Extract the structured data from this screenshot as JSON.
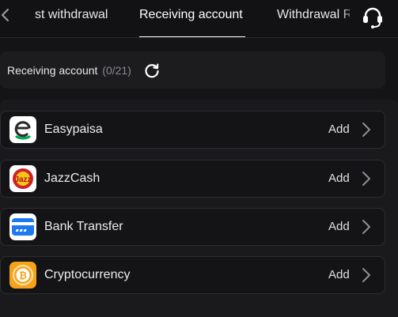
{
  "tabs": [
    {
      "label": "st withdrawal"
    },
    {
      "label": "Receiving account",
      "active": true
    },
    {
      "label": "Withdrawal R"
    }
  ],
  "header": {
    "title": "Receiving account",
    "count": "(0/21)"
  },
  "methods": [
    {
      "name": "Easypaisa",
      "action": "Add",
      "icon": "easypaisa-icon"
    },
    {
      "name": "JazzCash",
      "action": "Add",
      "icon": "jazzcash-icon"
    },
    {
      "name": "Bank Transfer",
      "action": "Add",
      "icon": "bank-card-icon"
    },
    {
      "name": "Cryptocurrency",
      "action": "Add",
      "icon": "bitcoin-icon"
    }
  ],
  "colors": {
    "background": "#141416",
    "panel": "#1a1a1d",
    "easypaisa": "#00a650",
    "jazzcash": "#d01f2a",
    "bank": "#1e78f0",
    "crypto": "#f7a21b"
  }
}
